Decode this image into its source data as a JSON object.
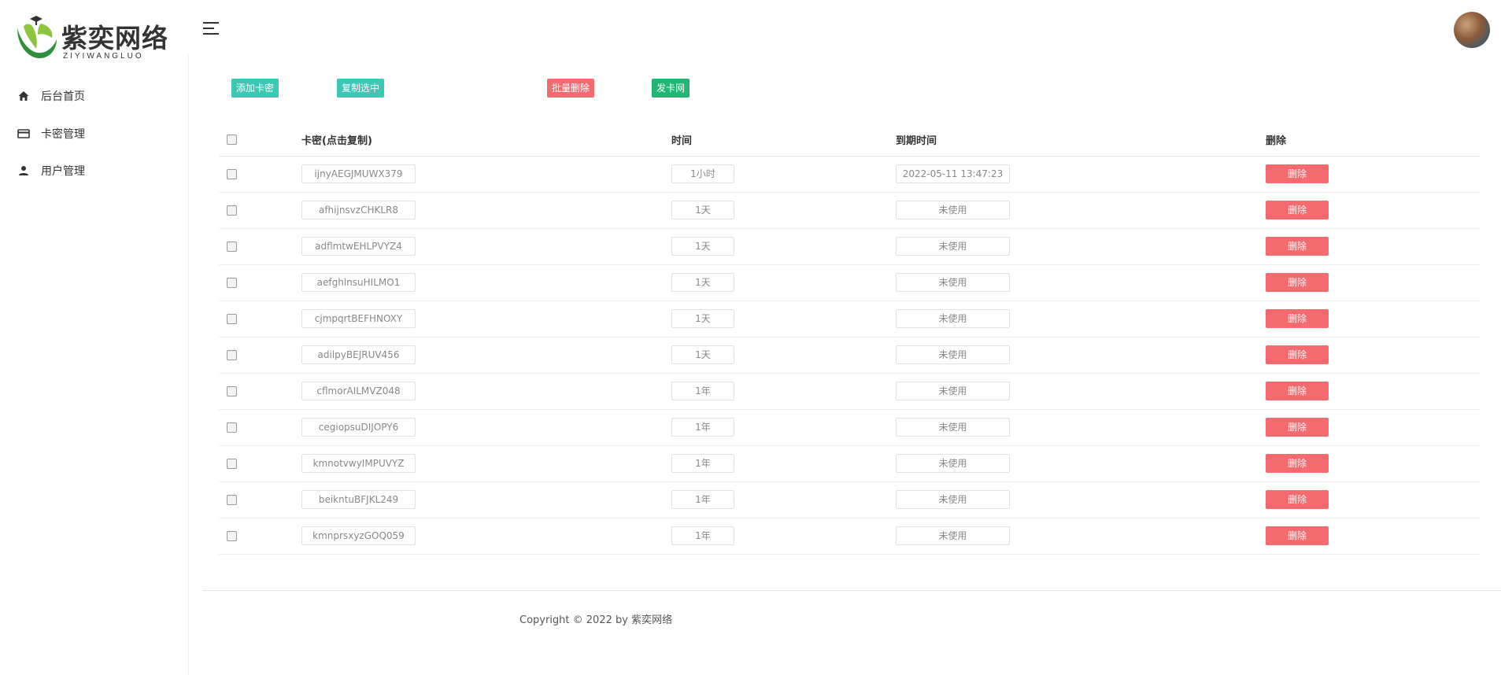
{
  "brand": {
    "name": "紫奕网络",
    "sub": "ZIYIWANGLUO"
  },
  "sidebar": {
    "items": [
      {
        "label": "后台首页",
        "icon": "home-icon"
      },
      {
        "label": "卡密管理",
        "icon": "card-icon"
      },
      {
        "label": "用户管理",
        "icon": "user-icon"
      }
    ]
  },
  "toolbar": {
    "add_label": "添加卡密",
    "copy_label": "复制选中",
    "batch_delete_label": "批量删除",
    "faka_label": "发卡网"
  },
  "table": {
    "headers": {
      "code": "卡密(点击复制)",
      "time": "时间",
      "expire": "到期时间",
      "delete": "删除"
    },
    "rows": [
      {
        "code": "ijnyAEGJMUWX379",
        "time": "1小时",
        "expire": "2022-05-11 13:47:23",
        "delete": "删除"
      },
      {
        "code": "afhijnsvzCHKLR8",
        "time": "1天",
        "expire": "未使用",
        "delete": "删除"
      },
      {
        "code": "adflmtwEHLPVYZ4",
        "time": "1天",
        "expire": "未使用",
        "delete": "删除"
      },
      {
        "code": "aefghlnsuHILMO1",
        "time": "1天",
        "expire": "未使用",
        "delete": "删除"
      },
      {
        "code": "cjmpqrtBEFHNOXY",
        "time": "1天",
        "expire": "未使用",
        "delete": "删除"
      },
      {
        "code": "adilpyBEJRUV456",
        "time": "1天",
        "expire": "未使用",
        "delete": "删除"
      },
      {
        "code": "cflmorAILMVZ048",
        "time": "1年",
        "expire": "未使用",
        "delete": "删除"
      },
      {
        "code": "cegiopsuDIJOPY6",
        "time": "1年",
        "expire": "未使用",
        "delete": "删除"
      },
      {
        "code": "kmnotvwyIMPUVYZ",
        "time": "1年",
        "expire": "未使用",
        "delete": "删除"
      },
      {
        "code": "beikntuBFJKL249",
        "time": "1年",
        "expire": "未使用",
        "delete": "删除"
      },
      {
        "code": "kmnprsxyzGOQ059",
        "time": "1年",
        "expire": "未使用",
        "delete": "删除"
      }
    ]
  },
  "footer": {
    "copyright": "Copyright © 2022 by 紫奕网络"
  },
  "colors": {
    "teal": "#3cc8b4",
    "red": "#f36a6f",
    "green": "#22b573"
  }
}
